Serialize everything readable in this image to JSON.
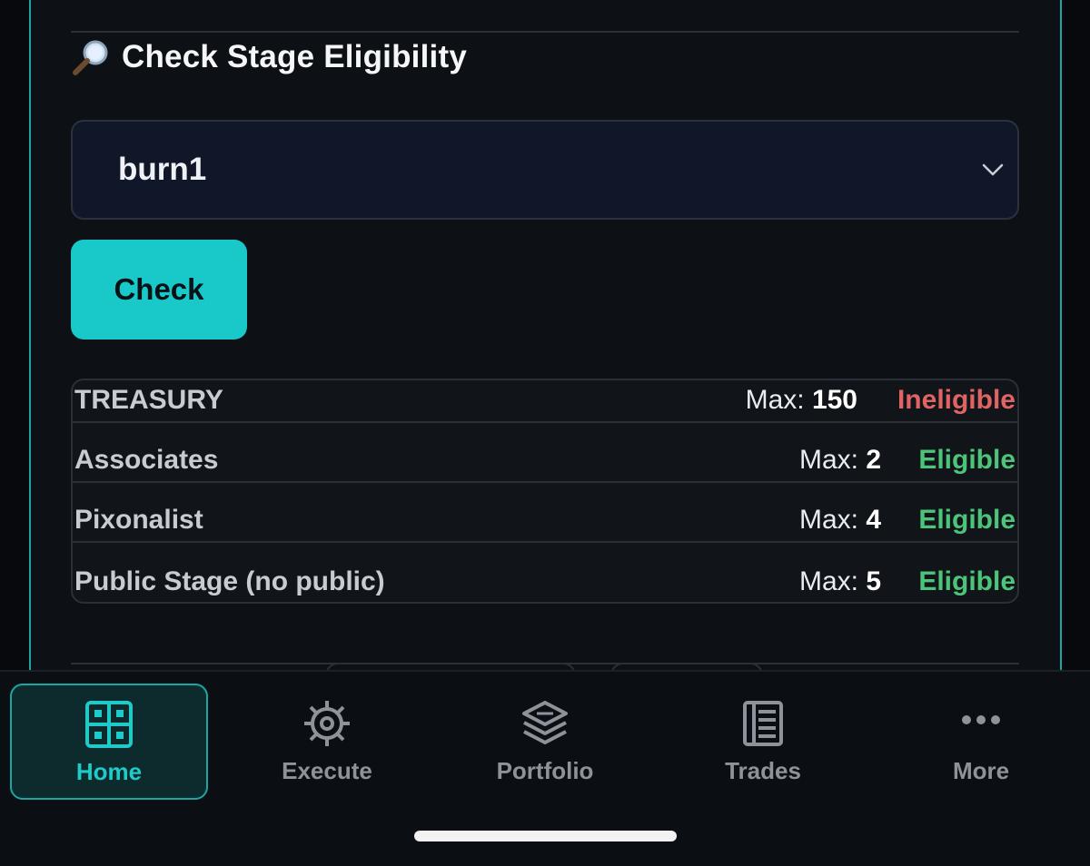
{
  "section": {
    "title": "Check Stage Eligibility",
    "title_icon": "magnifying-glass-icon"
  },
  "select": {
    "value": "burn1",
    "icon": "chevron-down-icon"
  },
  "check_button": {
    "label": "Check"
  },
  "results": {
    "max_label": "Max:",
    "rows": [
      {
        "name": "TREASURY",
        "max": "150",
        "status": "Ineligible"
      },
      {
        "name": "Associates",
        "max": "2",
        "status": "Eligible"
      },
      {
        "name": "Pixonalist",
        "max": "4",
        "status": "Eligible"
      },
      {
        "name": "Public Stage (no public)",
        "max": "5",
        "status": "Eligible"
      }
    ]
  },
  "colors": {
    "accent": "#19c9c9",
    "eligible": "#4cc57a",
    "ineligible": "#e06464"
  },
  "nav": {
    "items": [
      {
        "label": "Home",
        "icon": "grid-icon",
        "active": true
      },
      {
        "label": "Execute",
        "icon": "crosshair-gear-icon",
        "active": false
      },
      {
        "label": "Portfolio",
        "icon": "layers-icon",
        "active": false
      },
      {
        "label": "Trades",
        "icon": "list-icon",
        "active": false
      },
      {
        "label": "More",
        "icon": "more-dots-icon",
        "active": false
      }
    ]
  }
}
